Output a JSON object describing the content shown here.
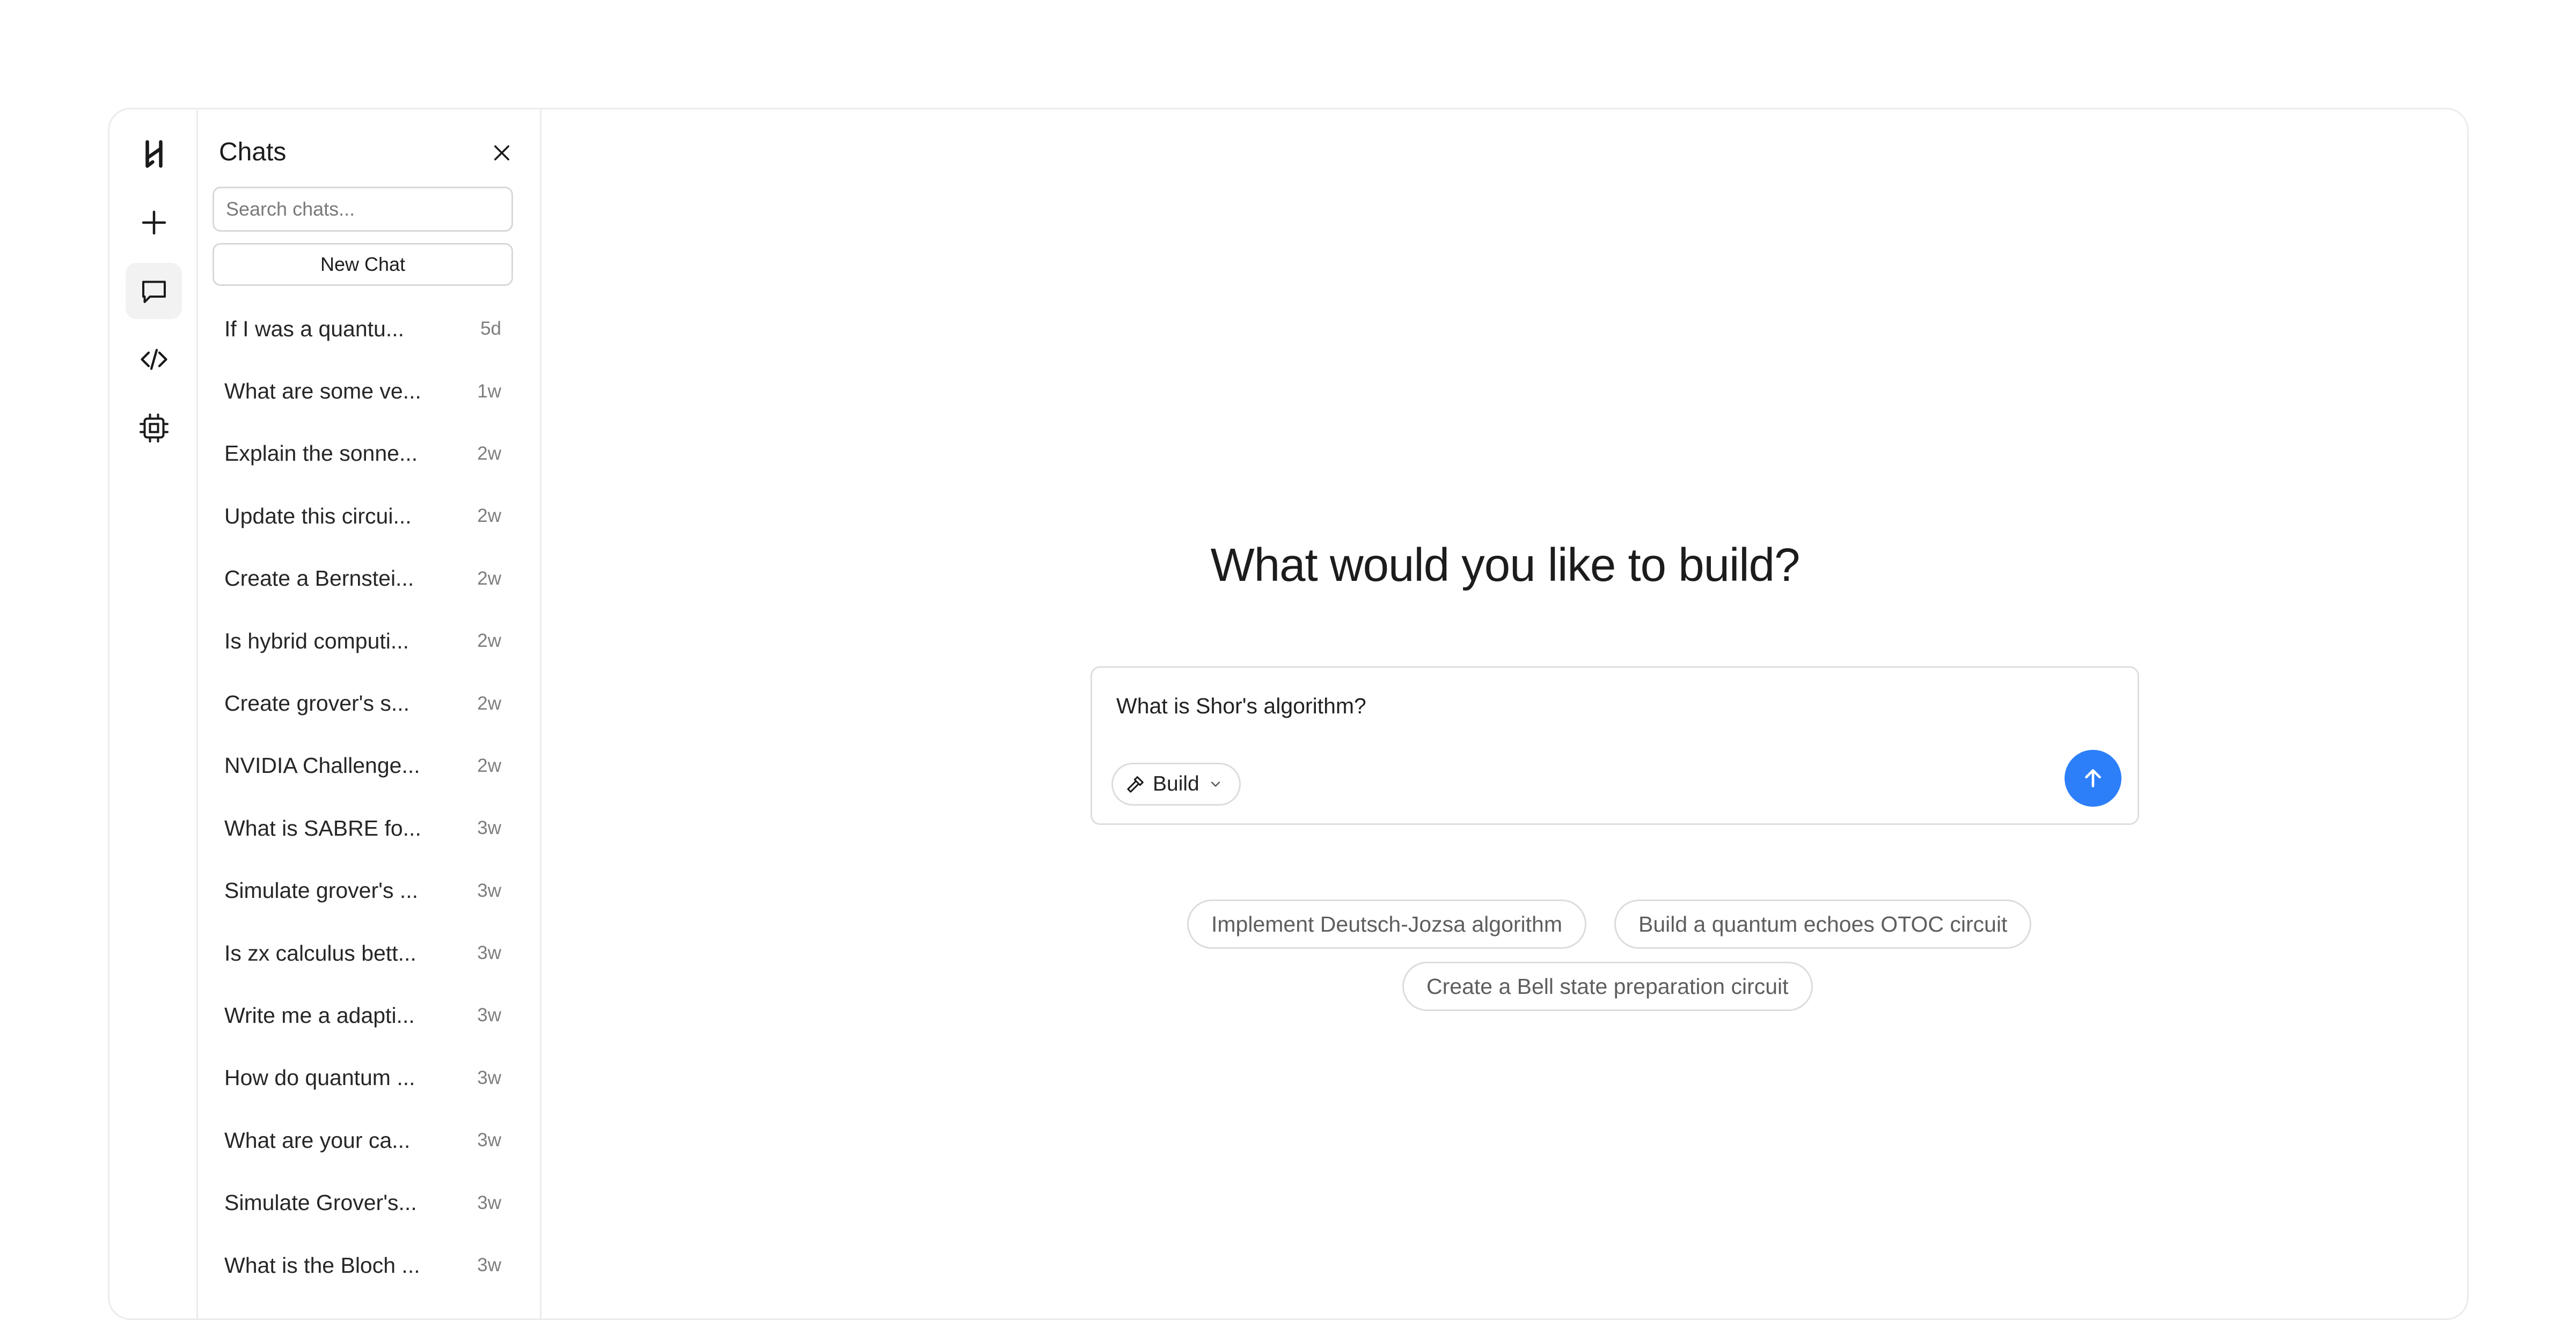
{
  "rail": {
    "items": [
      {
        "name": "logo-icon"
      },
      {
        "name": "plus-icon"
      },
      {
        "name": "chat-bubble-icon",
        "active": true
      },
      {
        "name": "code-icon"
      },
      {
        "name": "chip-icon"
      }
    ]
  },
  "chats": {
    "title": "Chats",
    "search_placeholder": "Search chats...",
    "new_chat_label": "New Chat",
    "items": [
      {
        "title": "If I was a quantu...",
        "time": "5d"
      },
      {
        "title": "What are some ve...",
        "time": "1w"
      },
      {
        "title": "Explain the sonne...",
        "time": "2w"
      },
      {
        "title": "Update this circui...",
        "time": "2w"
      },
      {
        "title": "Create a Bernstei...",
        "time": "2w"
      },
      {
        "title": "Is hybrid computi...",
        "time": "2w"
      },
      {
        "title": "Create grover's s...",
        "time": "2w"
      },
      {
        "title": "NVIDIA Challenge...",
        "time": "2w"
      },
      {
        "title": "What is SABRE fo...",
        "time": "3w"
      },
      {
        "title": "Simulate grover's ...",
        "time": "3w"
      },
      {
        "title": "Is zx calculus bett...",
        "time": "3w"
      },
      {
        "title": "Write me a adapti...",
        "time": "3w"
      },
      {
        "title": "How do quantum ...",
        "time": "3w"
      },
      {
        "title": "What are your ca...",
        "time": "3w"
      },
      {
        "title": "Simulate Grover's...",
        "time": "3w"
      },
      {
        "title": "What is the Bloch ...",
        "time": "3w"
      }
    ]
  },
  "main": {
    "heading": "What would you like to build?",
    "composer": {
      "value": "What is Shor's algorithm?",
      "mode_label": "Build"
    },
    "suggestions": [
      "Implement Deutsch-Jozsa algorithm",
      "Build a quantum echoes OTOC circuit",
      "Create a Bell state preparation circuit"
    ]
  },
  "colors": {
    "accent": "#2d7ff9",
    "border": "#ececec",
    "active_bg": "#f2f2f2"
  }
}
